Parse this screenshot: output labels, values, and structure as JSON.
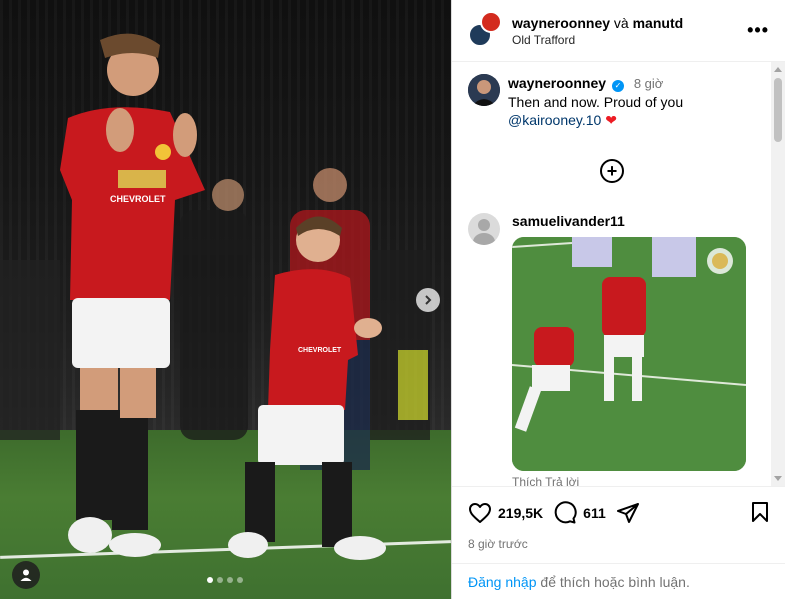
{
  "post": {
    "carousel": {
      "slide_count": 4,
      "active_index": 0,
      "next_icon": "chevron-right-icon",
      "tag_icon": "user-tag-icon"
    }
  },
  "header": {
    "user1": "wayneroonney",
    "joiner": "và",
    "user2": "manutd",
    "location": "Old Trafford",
    "more_icon": "more-horizontal-icon",
    "more_label": "•••"
  },
  "caption": {
    "user": "wayneroonney",
    "time": "8 giờ",
    "text": "Then and now. Proud of you",
    "mention": "@kairooney.10",
    "emoji": "❤"
  },
  "load_more": {
    "icon": "plus-circle-icon",
    "label": "+"
  },
  "comment": {
    "user": "samuelivander11",
    "meta": "Thích    Trả lời"
  },
  "actions": {
    "likes": "219,5K",
    "comments": "611",
    "like_icon": "heart-icon",
    "comment_icon": "comment-icon",
    "share_icon": "share-icon",
    "save_icon": "bookmark-icon",
    "posted": "8 giờ trước"
  },
  "login": {
    "link": "Đăng nhập",
    "rest": " để thích hoặc bình luận."
  },
  "colors": {
    "link": "#0095f6",
    "mention": "#00376b",
    "verified": "#0095f6",
    "heart": "#ed1c24"
  }
}
